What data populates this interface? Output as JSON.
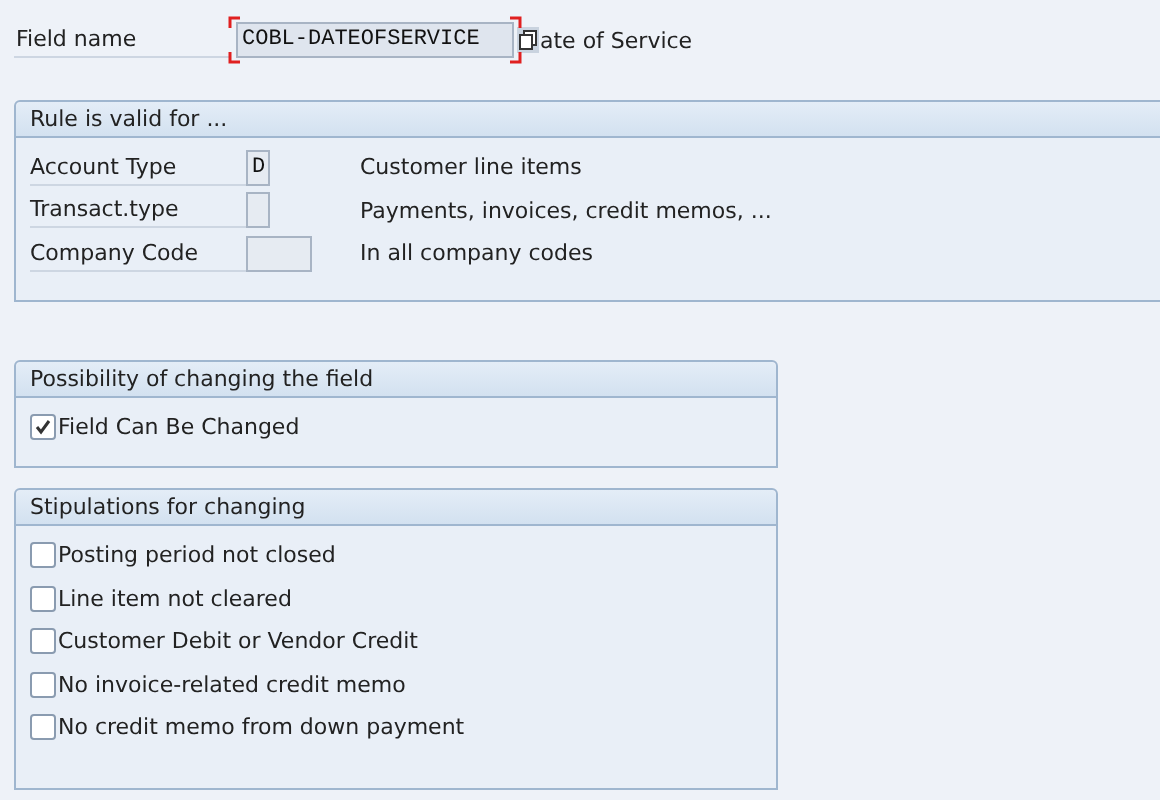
{
  "field_name": {
    "label": "Field name",
    "value": "COBL-DATEOFSERVICE",
    "focused": true,
    "description": "ate of Service"
  },
  "rule_group": {
    "title": "Rule is valid for ...",
    "rows": [
      {
        "label": "Account Type",
        "value": "D",
        "kind": "char",
        "description": "Customer line items"
      },
      {
        "label": "Transact.type",
        "value": "",
        "kind": "char",
        "description": "Payments, invoices, credit memos, ..."
      },
      {
        "label": "Company Code",
        "value": "",
        "kind": "code",
        "description": "In all company codes"
      }
    ]
  },
  "change_group": {
    "title": "Possibility of changing the field",
    "options": [
      {
        "label": "Field Can Be Changed",
        "checked": true
      }
    ]
  },
  "stipulations_group": {
    "title": "Stipulations for changing",
    "options": [
      {
        "label": "Posting period not closed",
        "checked": false
      },
      {
        "label": "Line item not cleared",
        "checked": false
      },
      {
        "label": "Customer Debit or Vendor Credit",
        "checked": false
      },
      {
        "label": "No invoice-related credit memo",
        "checked": false
      },
      {
        "label": "No credit memo from down payment",
        "checked": false
      }
    ]
  }
}
